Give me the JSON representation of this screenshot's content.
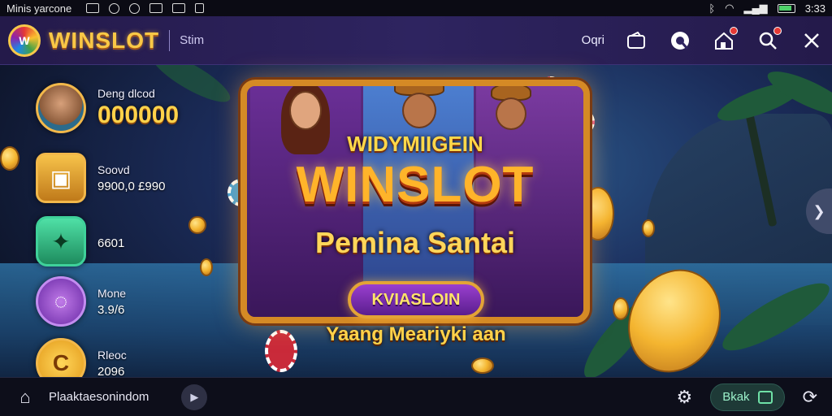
{
  "statusbar": {
    "title": "Minis yarcone",
    "time": "3:33",
    "icons": [
      "image-icon",
      "settings-icon",
      "alarm-icon",
      "grid-icon",
      "mail-icon",
      "sd-card-icon"
    ],
    "right_icons": [
      "bluetooth-icon",
      "wifi-icon",
      "signal-icon",
      "battery-icon"
    ]
  },
  "header": {
    "logo_text": "W",
    "brand": "WINSLOT",
    "subnav": "Stim",
    "right_text": "Oqri",
    "buttons": [
      "wallet-icon",
      "chat-icon",
      "home-alert-icon",
      "search-icon",
      "close-icon"
    ]
  },
  "sidebar": {
    "items": [
      {
        "label": "Deng dlcod",
        "value": "000000",
        "icon": "avatar-icon"
      },
      {
        "label": "Soovd",
        "value": "9900,0 £990",
        "icon": "treasure-chest-icon"
      },
      {
        "label": "",
        "value": "6601",
        "icon": "cash-icon"
      },
      {
        "label": "Mone",
        "value": "3.9/6",
        "icon": "swirl-badge-icon"
      },
      {
        "label": "Rleoc",
        "value": "2096",
        "icon": "coin-c-icon"
      }
    ]
  },
  "banner": {
    "subtitle": "WIDYMIIGEIN",
    "title": "WINSLOT",
    "tagline": "Pemina Santai",
    "cta": "KVIASLOIN",
    "cta_sub": "Yaang Meariyki aan"
  },
  "bottom": {
    "label": "Plaaktaesonindom",
    "pill_label": "Bkak"
  },
  "colors": {
    "brand_gold": "#f9c846",
    "header_bg": "#2e2460",
    "panel_border": "#d58a25",
    "cta_purple": "#9a3fcf"
  }
}
